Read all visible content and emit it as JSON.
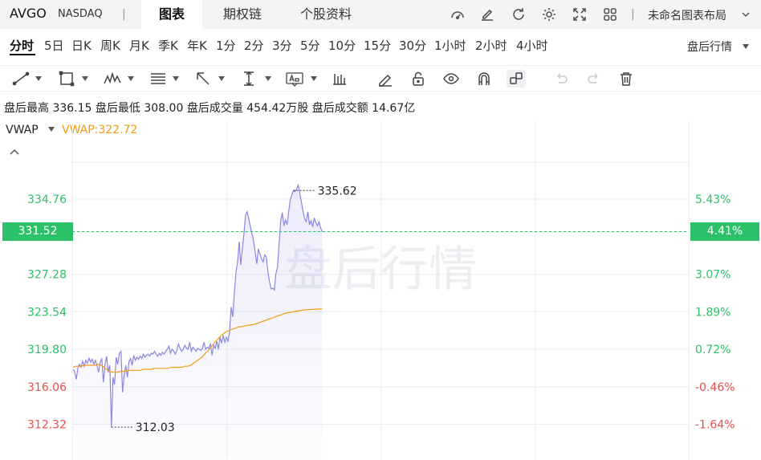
{
  "header": {
    "symbol": "AVGO",
    "exchange": "NASDAQ",
    "separator": "|",
    "tabs": [
      "图表",
      "期权链",
      "个股资料"
    ],
    "active_tab": "图表",
    "layout_label": "未命名图表布局",
    "icons": [
      "speedometer-icon",
      "pencil-edit-icon",
      "refresh-icon",
      "gear-icon",
      "fullscreen-icon",
      "grid-layout-icon"
    ]
  },
  "periods": {
    "items": [
      "分时",
      "5日",
      "日K",
      "周K",
      "月K",
      "季K",
      "年K",
      "1分",
      "2分",
      "3分",
      "5分",
      "10分",
      "15分",
      "30分",
      "1小时",
      "2小时",
      "4小时"
    ],
    "active": "分时",
    "session_label": "盘后行情"
  },
  "toolbar": {
    "tools": [
      "trend-line-icon",
      "rectangle-icon",
      "wave-pattern-icon",
      "fibonacci-icon",
      "arrow-icon",
      "measure-icon",
      "text-note-icon",
      "candlestick-icon",
      "eraser-pen-icon",
      "lock-icon",
      "eye-icon",
      "magnet-icon",
      "link-icon",
      "undo-icon",
      "redo-icon",
      "trash-icon"
    ]
  },
  "info": {
    "high_label": "盘后最高",
    "high": "336.15",
    "low_label": "盘后最低",
    "low": "308.00",
    "vol_label": "盘后成交量",
    "vol": "454.42万股",
    "amt_label": "盘后成交额",
    "amt": "14.67亿"
  },
  "indicator": {
    "name": "VWAP",
    "value_text": "VWAP:322.72",
    "color": "#f39c12"
  },
  "watermark": "盘后行情",
  "colors": {
    "up": "#2cc069",
    "down": "#ea4d4d",
    "price_line": "#8b85e6",
    "vwap_line": "#f39c12"
  },
  "chart_data": {
    "type": "line",
    "ylim": [
      310.5,
      338.5
    ],
    "y_ticks": [
      "334.76",
      "331.52",
      "327.28",
      "323.54",
      "319.80",
      "316.06",
      "312.32"
    ],
    "pct_ticks": [
      "5.43%",
      "4.41%",
      "3.07%",
      "1.89%",
      "0.72%",
      "-0.46%",
      "-1.64%"
    ],
    "current_price": "331.52",
    "current_pct": "4.41%",
    "max_label": "335.62",
    "min_label": "312.03",
    "series": [
      {
        "name": "price",
        "values": [
          317.8,
          317.6,
          316.8,
          317.9,
          318.3,
          318.0,
          318.6,
          318.1,
          318.7,
          318.4,
          318.9,
          318.5,
          318.8,
          318.3,
          318.7,
          318.2,
          317.5,
          318.5,
          318.9,
          316.5,
          318.3,
          319.1,
          317.5,
          318.2,
          312.03,
          317.0,
          316.3,
          319.0,
          318.3,
          319.4,
          319.6,
          315.5,
          317.2,
          318.2,
          317.0,
          318.6,
          318.9,
          318.2,
          319.2,
          318.7,
          319.0,
          318.8,
          319.1,
          318.9,
          319.3,
          319.0,
          319.2,
          319.3,
          319.1,
          319.4,
          319.3,
          319.6,
          319.3,
          319.1,
          319.4,
          319.2,
          319.5,
          319.3,
          319.6,
          319.8,
          320.1,
          319.4,
          319.8,
          319.6,
          319.3,
          319.7,
          320.3,
          319.9,
          319.6,
          319.8,
          320.2,
          319.9,
          319.8,
          320.5,
          319.6,
          320.0,
          319.8,
          319.6,
          319.9,
          319.8,
          319.7,
          319.9,
          320.5,
          319.8,
          320.0,
          319.9,
          320.3,
          319.2,
          320.2,
          319.9,
          320.6,
          319.8,
          321.0,
          320.4,
          321.2,
          320.5,
          321.0,
          320.6,
          321.5,
          324.0,
          323.0,
          325.5,
          327.5,
          328.5,
          330.5,
          328.2,
          329.8,
          331.3,
          333.2,
          333.5,
          332.8,
          332.0,
          331.3,
          330.6,
          329.5,
          328.3,
          329.8,
          329.3,
          328.8,
          328.5,
          329.2,
          329.0,
          327.5,
          326.5,
          325.8,
          325.9,
          325.7,
          327.3,
          328.0,
          330.3,
          332.6,
          333.4,
          332.1,
          332.7,
          332.2,
          333.5,
          334.7,
          335.2,
          335.62,
          335.5,
          335.8,
          336.15,
          335.3,
          334.4,
          333.5,
          332.8,
          332.5,
          333.5,
          332.2,
          332.6,
          332.0,
          332.9,
          332.4,
          332.1,
          332.5,
          331.9,
          331.52
        ]
      },
      {
        "name": "VWAP",
        "values": [
          318.0,
          318.1,
          318.1,
          318.1,
          318.2,
          318.2,
          318.2,
          318.2,
          318.2,
          318.3,
          318.2,
          318.0,
          317.8,
          317.6,
          317.5,
          317.5,
          317.5,
          317.6,
          317.6,
          317.6,
          317.7,
          317.7,
          317.7,
          317.7,
          317.7,
          317.8,
          317.8,
          317.8,
          317.8,
          317.9,
          317.9,
          317.9,
          317.9,
          317.9,
          317.9,
          318.0,
          318.0,
          318.0,
          318.0,
          318.0,
          318.1,
          318.1,
          318.2,
          318.4,
          318.6,
          318.8,
          319.0,
          319.3,
          319.6,
          319.9,
          320.3,
          320.6,
          320.9,
          321.2,
          321.4,
          321.6,
          321.7,
          321.8,
          321.9,
          322.0,
          322.05,
          322.1,
          322.15,
          322.2,
          322.25,
          322.3,
          322.4,
          322.5,
          322.6,
          322.7,
          322.8,
          322.9,
          323.0,
          323.1,
          323.2,
          323.3,
          323.4,
          323.45,
          323.5,
          323.55,
          323.6,
          323.65,
          323.7,
          323.72,
          323.74,
          323.76,
          323.78,
          323.8,
          323.81,
          323.82
        ]
      }
    ]
  }
}
